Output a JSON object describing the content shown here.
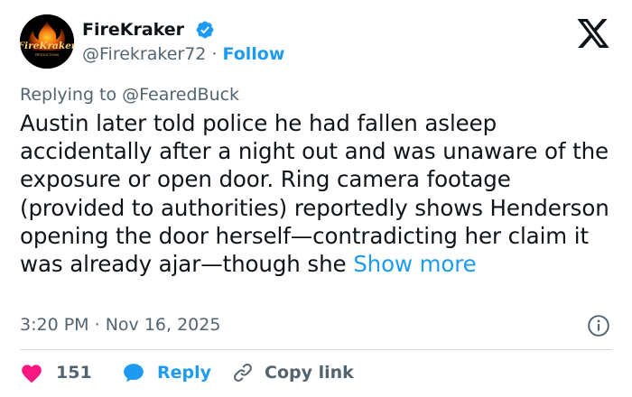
{
  "author": {
    "name": "FireKraker",
    "handle": "@Firekraker72",
    "separator": "·",
    "follow_label": "Follow",
    "avatar_text": "FireKraker",
    "avatar_subtext": "PRODUCTIONS",
    "verified": true
  },
  "reply_context": {
    "prefix": "Replying to",
    "target": "@FearedBuck"
  },
  "tweet": {
    "text": "Austin later told police he had fallen asleep accidentally after a night out and was unaware of the exposure or open door. Ring camera footage (provided to authorities) reportedly shows Henderson opening the door herself—contradicting her claim it was already ajar—though she",
    "show_more_label": "Show more"
  },
  "meta": {
    "time": "3:20 PM",
    "separator": "·",
    "date": "Nov 16, 2025"
  },
  "actions": {
    "like_count": "151",
    "reply_label": "Reply",
    "copy_link_label": "Copy link"
  },
  "colors": {
    "accent": "#1d9bf0",
    "like": "#f91880",
    "text": "#0f1419",
    "secondary": "#536471",
    "divider": "#cfd9de"
  },
  "icons": {
    "platform": "x-logo-icon",
    "verified": "verified-badge-icon",
    "info": "info-icon",
    "like": "heart-icon",
    "reply": "speech-bubble-icon",
    "copy": "link-icon"
  }
}
